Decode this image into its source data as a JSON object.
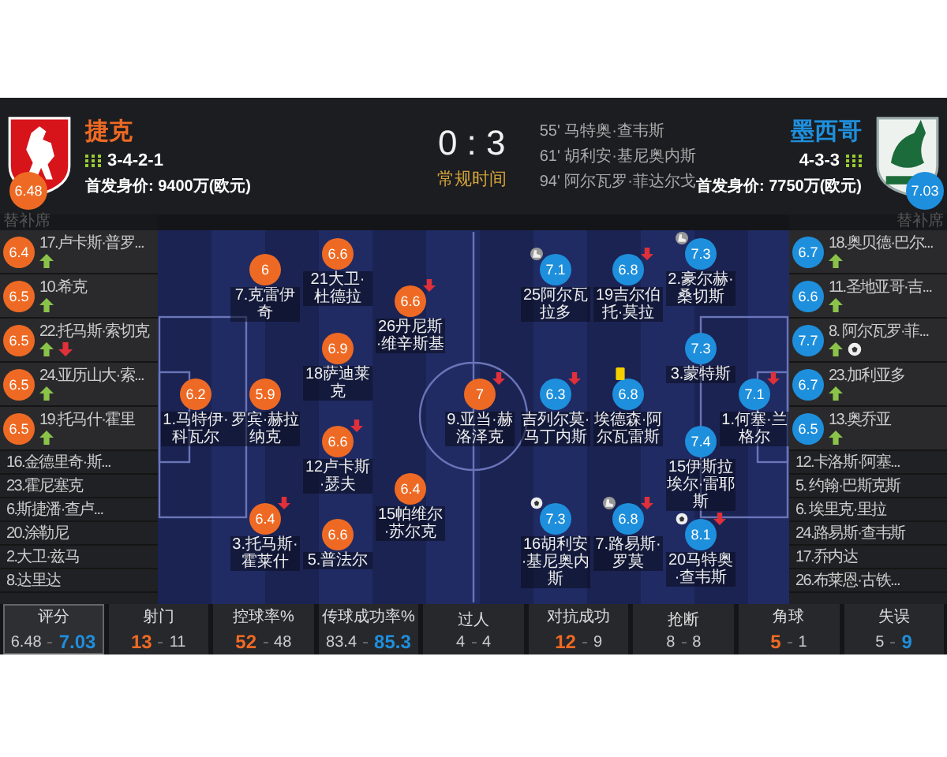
{
  "home": {
    "name": "捷克",
    "rating": "6.48",
    "formation": "3-4-2-1",
    "market_value": "首发身价: 9400万(欧元)",
    "bench_title": "替补席",
    "lines": [
      [
        {
          "label": "1.马特伊·科瓦尔",
          "rating": "6.2",
          "sub_off": false,
          "goal": false,
          "assist": false,
          "yellow_card": false
        }
      ],
      [
        {
          "label": "7.克雷伊奇",
          "rating": "6",
          "sub_off": false,
          "goal": false,
          "assist": false,
          "yellow_card": false
        },
        {
          "label": "罗宾·赫拉纳克",
          "rating": "5.9",
          "sub_off": false,
          "goal": false,
          "assist": false,
          "yellow_card": false
        },
        {
          "label": "3.托马斯·霍莱什",
          "rating": "6.4",
          "sub_off": true,
          "goal": false,
          "assist": false,
          "yellow_card": false
        }
      ],
      [
        {
          "label": "21大卫·杜德拉",
          "rating": "6.6",
          "sub_off": false,
          "goal": false,
          "assist": false,
          "yellow_card": false
        },
        {
          "label": "18萨迪莱克",
          "rating": "6.9",
          "sub_off": false,
          "goal": false,
          "assist": false,
          "yellow_card": false
        },
        {
          "label": "12卢卡斯·瑟夫",
          "rating": "6.6",
          "sub_off": true,
          "goal": false,
          "assist": false,
          "yellow_card": false
        },
        {
          "label": "5.普法尔",
          "rating": "6.6",
          "sub_off": false,
          "goal": false,
          "assist": false,
          "yellow_card": false
        }
      ],
      [
        {
          "label": "26丹尼斯·维辛斯基",
          "rating": "6.6",
          "sub_off": true,
          "goal": false,
          "assist": false,
          "yellow_card": false
        },
        {
          "label": "15帕维尔·苏尔克",
          "rating": "6.4",
          "sub_off": false,
          "goal": false,
          "assist": false,
          "yellow_card": false
        }
      ],
      [
        {
          "label": "9.亚当·赫洛泽克",
          "rating": "7",
          "sub_off": true,
          "goal": false,
          "assist": false,
          "yellow_card": false
        }
      ]
    ],
    "bench": [
      {
        "kind": "used",
        "name": "17.卢卡斯·普罗...",
        "rating": "6.4",
        "sub_on": true,
        "sub_off": false,
        "goal": false
      },
      {
        "kind": "used",
        "name": "10.希克",
        "rating": "6.5",
        "sub_on": true,
        "sub_off": false,
        "goal": false
      },
      {
        "kind": "used",
        "name": "22.托马斯·索切克",
        "rating": "6.5",
        "sub_on": true,
        "sub_off": true,
        "goal": false
      },
      {
        "kind": "used",
        "name": "24.亚历山大·索...",
        "rating": "6.5",
        "sub_on": true,
        "sub_off": false,
        "goal": false
      },
      {
        "kind": "used",
        "name": "19.托马什·霍里",
        "rating": "6.5",
        "sub_on": true,
        "sub_off": false,
        "goal": false
      },
      {
        "kind": "unused",
        "name": "16.金德里奇·斯..."
      },
      {
        "kind": "unused",
        "name": "23.霍尼塞克"
      },
      {
        "kind": "unused",
        "name": "6.斯捷潘·查卢..."
      },
      {
        "kind": "unused",
        "name": "20.涂勒尼"
      },
      {
        "kind": "unused",
        "name": "2.大卫·兹马"
      },
      {
        "kind": "unused",
        "name": "8.达里达"
      }
    ]
  },
  "score": "0 : 3",
  "period": "常规时间",
  "goals": [
    {
      "minute": "55'",
      "player": "马特奥·查韦斯"
    },
    {
      "minute": "61'",
      "player": "胡利安·基尼奥内斯"
    },
    {
      "minute": "94'",
      "player": "阿尔瓦罗·菲达尔戈"
    }
  ],
  "away": {
    "name": "墨西哥",
    "rating": "7.03",
    "formation": "4-3-3",
    "market_value": "首发身价: 7750万(欧元)",
    "bench_title": "替补席",
    "lines": [
      [
        {
          "label": "25阿尔瓦拉多",
          "rating": "7.1",
          "sub_off": false,
          "goal": false,
          "assist": true,
          "yellow_card": false
        },
        {
          "label": "吉列尔莫·马丁内斯",
          "rating": "6.3",
          "sub_off": true,
          "goal": false,
          "assist": false,
          "yellow_card": false
        },
        {
          "label": "16胡利安·基尼奥内斯",
          "rating": "7.3",
          "sub_off": false,
          "goal": true,
          "assist": false,
          "yellow_card": false
        }
      ],
      [
        {
          "label": "19吉尔伯托·莫拉",
          "rating": "6.8",
          "sub_off": true,
          "goal": false,
          "assist": false,
          "yellow_card": false
        },
        {
          "label": "埃德森·阿尔瓦雷斯",
          "rating": "6.8",
          "sub_off": false,
          "goal": false,
          "assist": false,
          "yellow_card": true
        },
        {
          "label": "7.路易斯·罗莫",
          "rating": "6.8",
          "sub_off": true,
          "goal": false,
          "assist": true,
          "yellow_card": false
        }
      ],
      [
        {
          "label": "2.豪尔赫·桑切斯",
          "rating": "7.3",
          "sub_off": false,
          "goal": false,
          "assist": true,
          "yellow_card": false
        },
        {
          "label": "3.蒙特斯",
          "rating": "7.3",
          "sub_off": false,
          "goal": false,
          "assist": false,
          "yellow_card": false
        },
        {
          "label": "15伊斯拉埃尔·雷耶斯",
          "rating": "7.4",
          "sub_off": false,
          "goal": false,
          "assist": false,
          "yellow_card": false
        },
        {
          "label": "20马特奥·查韦斯",
          "rating": "8.1",
          "sub_off": true,
          "goal": true,
          "assist": false,
          "yellow_card": false
        }
      ],
      [
        {
          "label": "1.何塞·兰格尔",
          "rating": "7.1",
          "sub_off": true,
          "goal": false,
          "assist": false,
          "yellow_card": false
        }
      ]
    ],
    "bench": [
      {
        "kind": "used",
        "name": "18.奥贝德·巴尔...",
        "rating": "6.7",
        "sub_on": true,
        "sub_off": false,
        "goal": false
      },
      {
        "kind": "used",
        "name": "11.圣地亚哥·吉...",
        "rating": "6.6",
        "sub_on": true,
        "sub_off": false,
        "goal": false
      },
      {
        "kind": "used",
        "name": "8. 阿尔瓦罗·菲...",
        "rating": "7.7",
        "sub_on": true,
        "sub_off": false,
        "goal": true
      },
      {
        "kind": "used",
        "name": "23.加利亚多",
        "rating": "6.7",
        "sub_on": true,
        "sub_off": false,
        "goal": false
      },
      {
        "kind": "used",
        "name": "13.奥乔亚",
        "rating": "6.5",
        "sub_on": true,
        "sub_off": false,
        "goal": false
      },
      {
        "kind": "unused",
        "name": "12.卡洛斯·阿塞..."
      },
      {
        "kind": "unused",
        "name": "5. 约翰·巴斯克斯"
      },
      {
        "kind": "unused",
        "name": "6. 埃里克·里拉"
      },
      {
        "kind": "unused",
        "name": "24.路易斯·查韦斯"
      },
      {
        "kind": "unused",
        "name": "17.乔内达"
      },
      {
        "kind": "unused",
        "name": "26.布莱恩·古铁..."
      }
    ]
  },
  "stats": [
    {
      "label": "评分",
      "home": "6.48",
      "away": "7.03",
      "home_highlighted": false,
      "away_highlighted": true,
      "selected": true
    },
    {
      "label": "射门",
      "home": "13",
      "away": "11",
      "home_highlighted": true,
      "away_highlighted": false,
      "selected": false
    },
    {
      "label": "控球率%",
      "home": "52",
      "away": "48",
      "home_highlighted": true,
      "away_highlighted": false,
      "selected": false
    },
    {
      "label": "传球成功率%",
      "home": "83.4",
      "away": "85.3",
      "home_highlighted": false,
      "away_highlighted": true,
      "selected": false
    },
    {
      "label": "过人",
      "home": "4",
      "away": "4",
      "home_highlighted": false,
      "away_highlighted": false,
      "selected": false
    },
    {
      "label": "对抗成功",
      "home": "12",
      "away": "9",
      "home_highlighted": true,
      "away_highlighted": false,
      "selected": false
    },
    {
      "label": "抢断",
      "home": "8",
      "away": "8",
      "home_highlighted": false,
      "away_highlighted": false,
      "selected": false
    },
    {
      "label": "角球",
      "home": "5",
      "away": "1",
      "home_highlighted": true,
      "away_highlighted": false,
      "selected": false
    },
    {
      "label": "失误",
      "home": "5",
      "away": "9",
      "home_highlighted": false,
      "away_highlighted": true,
      "selected": false
    }
  ]
}
